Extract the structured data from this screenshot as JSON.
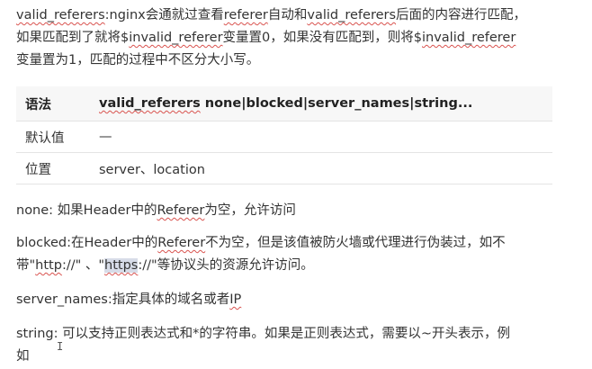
{
  "intro": {
    "line1_a": "valid_referers",
    "line1_b": ":nginx会通就过查看",
    "line1_c": "referer",
    "line1_d": "自动和",
    "line1_e": "valid_referers",
    "line1_f": "后面的内容进行匹配，",
    "line2_a": "如果匹配到了就将$",
    "line2_b": "invalid_referer",
    "line2_c": "变量置0，如果没有匹配到，则将$",
    "line2_d": "invalid_referer",
    "line3": "变量置为1，匹配的过程中不区分大小写。"
  },
  "table": {
    "header_key": "语法",
    "header_val_a": "valid_referers",
    "header_val_b": " none|blocked|server_names|string...",
    "rows": [
      {
        "key": "默认值",
        "value": "—"
      },
      {
        "key": "位置",
        "value": "server、location"
      }
    ]
  },
  "descriptions": {
    "none_a": "none: 如果Header中的",
    "none_b": "Referer",
    "none_c": "为空，允许访问",
    "blocked_a": "blocked:在Header中的",
    "blocked_b": "Referer",
    "blocked_c": "不为空，但是该值被防火墙或代理进行伪装过，如不",
    "blocked_d": "带\"",
    "blocked_e": "http",
    "blocked_f": "://\" 、\"",
    "blocked_g": "https",
    "blocked_h": "://\"等协议头的资源允许访问。",
    "server_a": "server_names:指定具体的域名或者",
    "server_b": "IP",
    "string_a": "string: 可以支持正则表达式和*的字符串。如果是正则表达式，需要以~开头表示，例",
    "string_b": "如"
  },
  "cursor_glyph": "I"
}
